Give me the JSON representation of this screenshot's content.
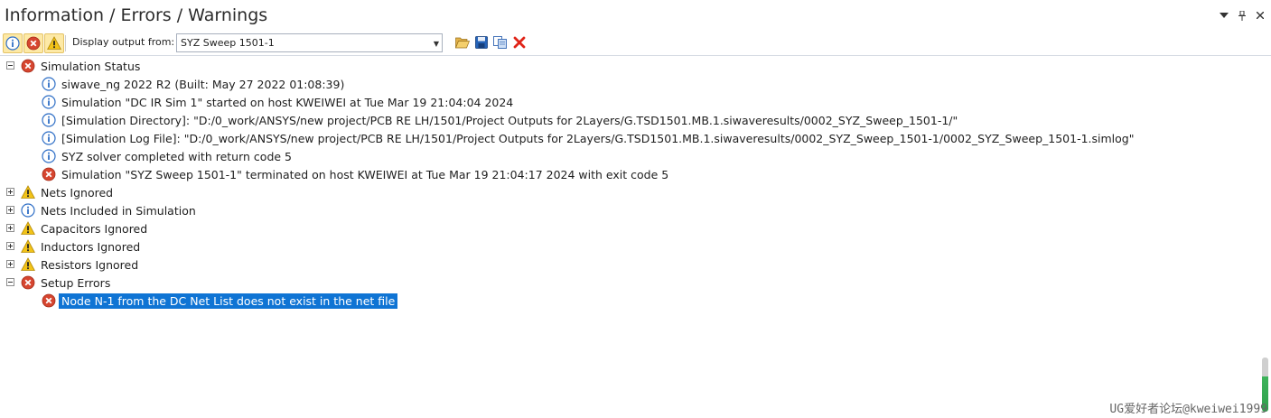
{
  "window": {
    "title": "Information / Errors / Warnings",
    "controls": [
      "dropdown-icon",
      "pin-icon",
      "close-icon"
    ]
  },
  "toolbar": {
    "filters": [
      {
        "name": "info-filter",
        "icon": "info-icon",
        "active": true
      },
      {
        "name": "error-filter",
        "icon": "error-icon",
        "active": true
      },
      {
        "name": "warning-filter",
        "icon": "warning-icon",
        "active": true
      }
    ],
    "display_label": "Display output from:",
    "display_value": "SYZ Sweep 1501-1",
    "tools": [
      "open-folder-icon",
      "save-icon",
      "copy-icon",
      "delete-icon"
    ]
  },
  "tree": [
    {
      "level": 0,
      "expander": "minus",
      "icon": "error",
      "text": "Simulation Status"
    },
    {
      "level": 1,
      "icon": "info",
      "text": "siwave_ng 2022 R2 (Built: May 27 2022 01:08:39)"
    },
    {
      "level": 1,
      "icon": "info",
      "text": "Simulation \"DC IR Sim 1\" started on host KWEIWEI at Tue Mar 19 21:04:04 2024"
    },
    {
      "level": 1,
      "icon": "info",
      "text": "[Simulation Directory]: \"D:/0_work/ANSYS/new project/PCB RE LH/1501/Project Outputs for 2Layers/G.TSD1501.MB.1.siwaveresults/0002_SYZ_Sweep_1501-1/\""
    },
    {
      "level": 1,
      "icon": "info",
      "text": "[Simulation Log File]: \"D:/0_work/ANSYS/new project/PCB RE LH/1501/Project Outputs for 2Layers/G.TSD1501.MB.1.siwaveresults/0002_SYZ_Sweep_1501-1/0002_SYZ_Sweep_1501-1.simlog\""
    },
    {
      "level": 1,
      "icon": "info",
      "text": "SYZ solver completed with return code 5"
    },
    {
      "level": 1,
      "icon": "error",
      "text": "Simulation \"SYZ Sweep 1501-1\" terminated on host KWEIWEI at Tue Mar 19 21:04:17 2024 with exit code 5"
    },
    {
      "level": 0,
      "expander": "plus",
      "icon": "warning",
      "text": "Nets Ignored"
    },
    {
      "level": 0,
      "expander": "plus",
      "icon": "info",
      "text": "Nets Included in Simulation"
    },
    {
      "level": 0,
      "expander": "plus",
      "icon": "warning",
      "text": "Capacitors Ignored"
    },
    {
      "level": 0,
      "expander": "plus",
      "icon": "warning",
      "text": "Inductors Ignored"
    },
    {
      "level": 0,
      "expander": "plus",
      "icon": "warning",
      "text": "Resistors Ignored"
    },
    {
      "level": 0,
      "expander": "minus",
      "icon": "error",
      "text": "Setup Errors"
    },
    {
      "level": 1,
      "icon": "error",
      "text": "Node N-1 from the DC Net List does not exist in the net file",
      "selected": true
    }
  ],
  "watermark": "UG爱好者论坛@kweiwei1999",
  "colors": {
    "selection": "#0f74d4",
    "info": "#2f6fc6",
    "error": "#d6452f",
    "warning": "#f2c318"
  }
}
